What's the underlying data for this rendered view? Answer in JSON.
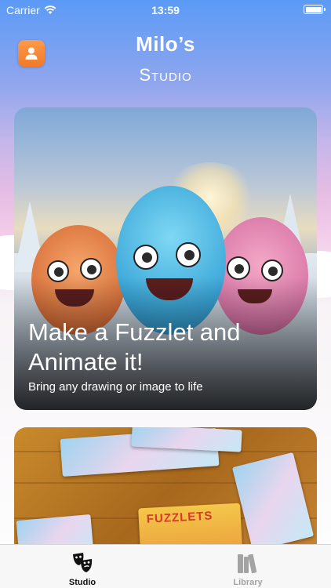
{
  "status_bar": {
    "carrier": "Carrier",
    "time": "13:59",
    "wifi_icon": "wifi-icon",
    "battery_icon": "battery-icon"
  },
  "header": {
    "title": "Milo’s",
    "subtitle": "Studio",
    "profile_icon": "person-icon",
    "profile_color": "#f4873a"
  },
  "cards": [
    {
      "title": "Make a Fuzzlet and Animate it!",
      "subtitle": "Bring any drawing or image to life",
      "image": "three-fuzzy-monsters-snow-scene"
    },
    {
      "image": "fuzzlets-puzzle-pieces-on-table",
      "box_text": "FUZZLETS"
    }
  ],
  "tab_bar": {
    "tabs": [
      {
        "label": "Studio",
        "icon": "theater-masks-icon",
        "selected": true
      },
      {
        "label": "Library",
        "icon": "books-icon",
        "selected": false
      }
    ]
  },
  "colors": {
    "sky_top": "#5b9af6",
    "accent_orange": "#f4873a",
    "tab_selected": "#111111",
    "tab_unselected": "#a3a3a3"
  }
}
